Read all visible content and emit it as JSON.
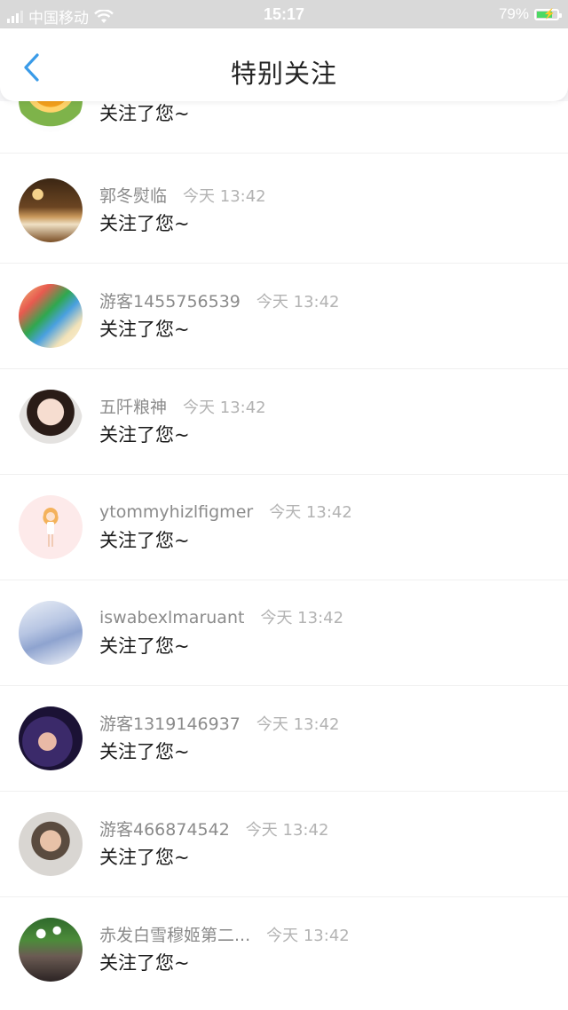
{
  "status_bar": {
    "carrier": "中国移动",
    "time": "15:17",
    "battery": "79%"
  },
  "header": {
    "title": "特别关注"
  },
  "items": [
    {
      "name": "",
      "time": "",
      "message": "关注了您~",
      "avatar": "sunflower"
    },
    {
      "name": "郭冬熨临",
      "time": "今天 13:42",
      "message": "关注了您~",
      "avatar": "open-book"
    },
    {
      "name": "游客1455756539",
      "time": "今天 13:42",
      "message": "关注了您~",
      "avatar": "colored-pencils"
    },
    {
      "name": "五阡粮神",
      "time": "今天 13:42",
      "message": "关注了您~",
      "avatar": "girl-portrait"
    },
    {
      "name": "ytommyhizlfigmer",
      "time": "今天 13:42",
      "message": "关注了您~",
      "avatar": "cartoon-girl"
    },
    {
      "name": "iswabexlmaruant",
      "time": "今天 13:42",
      "message": "关注了您~",
      "avatar": "girl-in-kimono"
    },
    {
      "name": "游客1319146937",
      "time": "今天 13:42",
      "message": "关注了您~",
      "avatar": "anime-couple"
    },
    {
      "name": "游客466874542",
      "time": "今天 13:42",
      "message": "关注了您~",
      "avatar": "boy-portrait"
    },
    {
      "name": "赤发白雪穆姬第二...",
      "time": "今天 13:42",
      "message": "关注了您~",
      "avatar": "flower-girl"
    }
  ],
  "colors": {
    "accent": "#3a9be8",
    "name_text": "#8b8b8b",
    "time_text": "#b3b3b3"
  }
}
